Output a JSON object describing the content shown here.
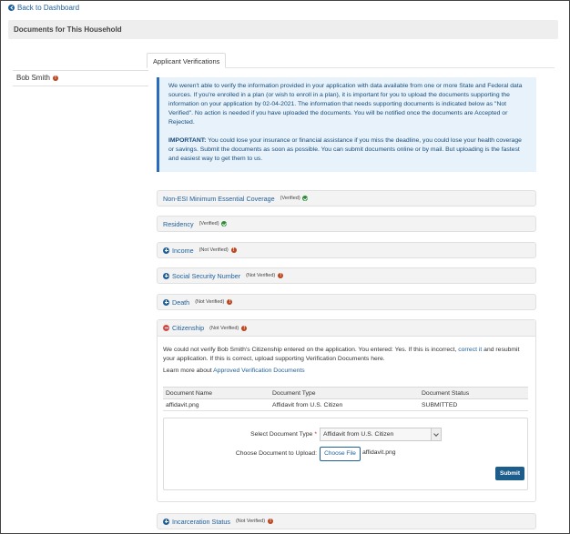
{
  "nav": {
    "back_label": "Back to Dashboard"
  },
  "header": {
    "title": "Documents for This Household"
  },
  "sidebar": {
    "items": [
      {
        "label": "Bob Smith"
      }
    ]
  },
  "tabs": [
    {
      "label": "Applicant Verifications"
    }
  ],
  "notice": {
    "paragraph1": "We weren't able to verify the information provided in your application with data available from one or more State and Federal data sources. If you're enrolled in a plan (or wish to enroll in a plan), it is important for you to upload the documents supporting the information on your application by 02-04-2021. The information that needs supporting documents is indicated below as \"Not Verified\". No action is needed if you have uploaded the documents. You will be notified once the documents are Accepted or Rejected.",
    "important_label": "IMPORTANT:",
    "important_text": " You could lose your insurance or financial assistance if you miss the deadline, you could lose your health coverage or savings. Submit the documents as soon as possible. You can submit documents online or by mail. But uploading is the fastest and easiest way to get them to us."
  },
  "verifications": [
    {
      "title": "Non-ESI Minimum Essential Coverage",
      "status": "(Verified)"
    },
    {
      "title": "Residency",
      "status": "(Verified)"
    },
    {
      "title": "Income",
      "status": "(Not Verified)"
    },
    {
      "title": "Social Security Number",
      "status": "(Not Verified)"
    },
    {
      "title": "Death",
      "status": "(Not Verified)"
    },
    {
      "title": "Citizenship",
      "status": "(Not Verified)"
    },
    {
      "title": "Incarceration Status",
      "status": "(Not Verified)"
    }
  ],
  "citizenship": {
    "text_before": "We could not verify Bob Smith's Citizenship entered on the application. You entered: Yes. If this is incorrect, ",
    "correct_link": "correct it",
    "text_after": " and resubmit your application. If this is correct, upload supporting Verification Documents here.",
    "learn_prefix": "Learn more about ",
    "learn_link": "Approved Verification Documents",
    "table": {
      "headers": [
        "Document Name",
        "Document Type",
        "Document Status"
      ],
      "rows": [
        [
          "affidavit.png",
          "Affidavit from U.S. Citizen",
          "SUBMITTED"
        ]
      ]
    },
    "form": {
      "select_label": "Select Document Type",
      "required_mark": "*",
      "selected_type": "Affidavit from U.S. Citizen",
      "choose_label": "Choose Document to Upload:",
      "choose_button": "Choose File",
      "chosen_file": "affidavit.png",
      "submit_button": "Submit"
    }
  },
  "colors": {
    "link": "#1f5f99",
    "verified": "#2e8b3a",
    "not_verified": "#b9471f",
    "notice_bg": "#e7f2fa",
    "submit_bg": "#1c5d8c"
  },
  "icons": {
    "back": "chevron-left-circle-icon",
    "verified": "check-circle-icon",
    "not_verified": "exclamation-circle-icon",
    "expand": "plus-circle-icon",
    "collapse": "minus-circle-icon"
  }
}
